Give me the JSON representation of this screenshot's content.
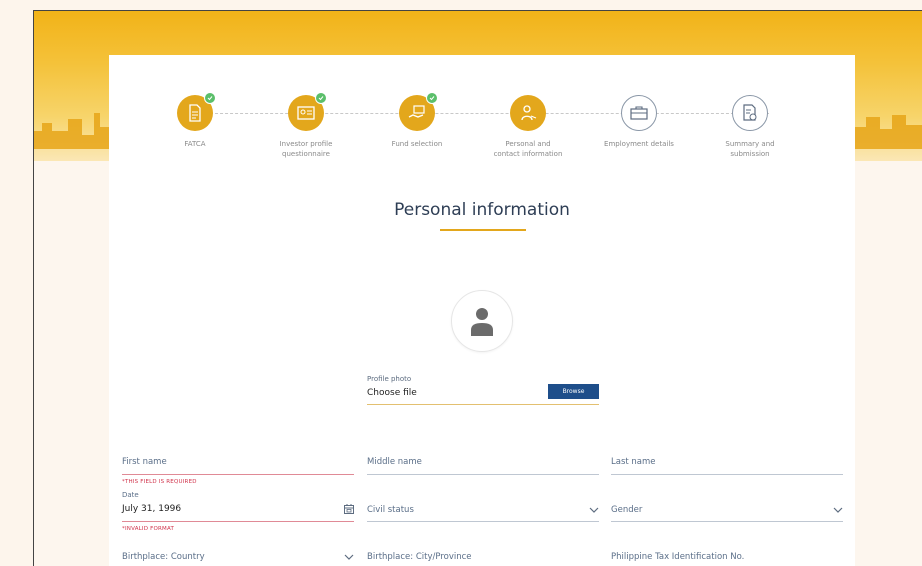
{
  "stepper": {
    "steps": [
      {
        "label_line1": "FATCA",
        "label_line2": "",
        "status": "done",
        "icon": "document-icon"
      },
      {
        "label_line1": "Investor profile",
        "label_line2": "questionnaire",
        "status": "done",
        "icon": "id-card-icon"
      },
      {
        "label_line1": "Fund selection",
        "label_line2": "",
        "status": "done",
        "icon": "hand-money-icon"
      },
      {
        "label_line1": "Personal and",
        "label_line2": "contact information",
        "status": "current",
        "icon": "person-hand-icon"
      },
      {
        "label_line1": "Employment details",
        "label_line2": "",
        "status": "todo",
        "icon": "briefcase-icon"
      },
      {
        "label_line1": "Summary and",
        "label_line2": "submission",
        "status": "todo",
        "icon": "document-check-icon"
      }
    ]
  },
  "page": {
    "title": "Personal information"
  },
  "upload": {
    "label": "Profile photo",
    "value": "Choose file",
    "button": "Browse"
  },
  "form": {
    "first_name": {
      "label": "First name",
      "error": "*THIS FIELD IS REQUIRED"
    },
    "middle_name": {
      "label": "Middle name"
    },
    "last_name": {
      "label": "Last name"
    },
    "date": {
      "label": "Date",
      "value": "July 31, 1996",
      "error": "*INVALID FORMAT"
    },
    "civil_status": {
      "label": "Civil status"
    },
    "gender": {
      "label": "Gender"
    },
    "birthplace_country": {
      "label": "Birthplace: Country"
    },
    "birthplace_city": {
      "label": "Birthplace: City/Province"
    },
    "tin": {
      "label": "Philippine Tax Identification No."
    }
  },
  "colors": {
    "accent": "#e3a71c",
    "primary": "#1e4e8a",
    "error": "#d0334b",
    "success": "#5bbf6b"
  }
}
